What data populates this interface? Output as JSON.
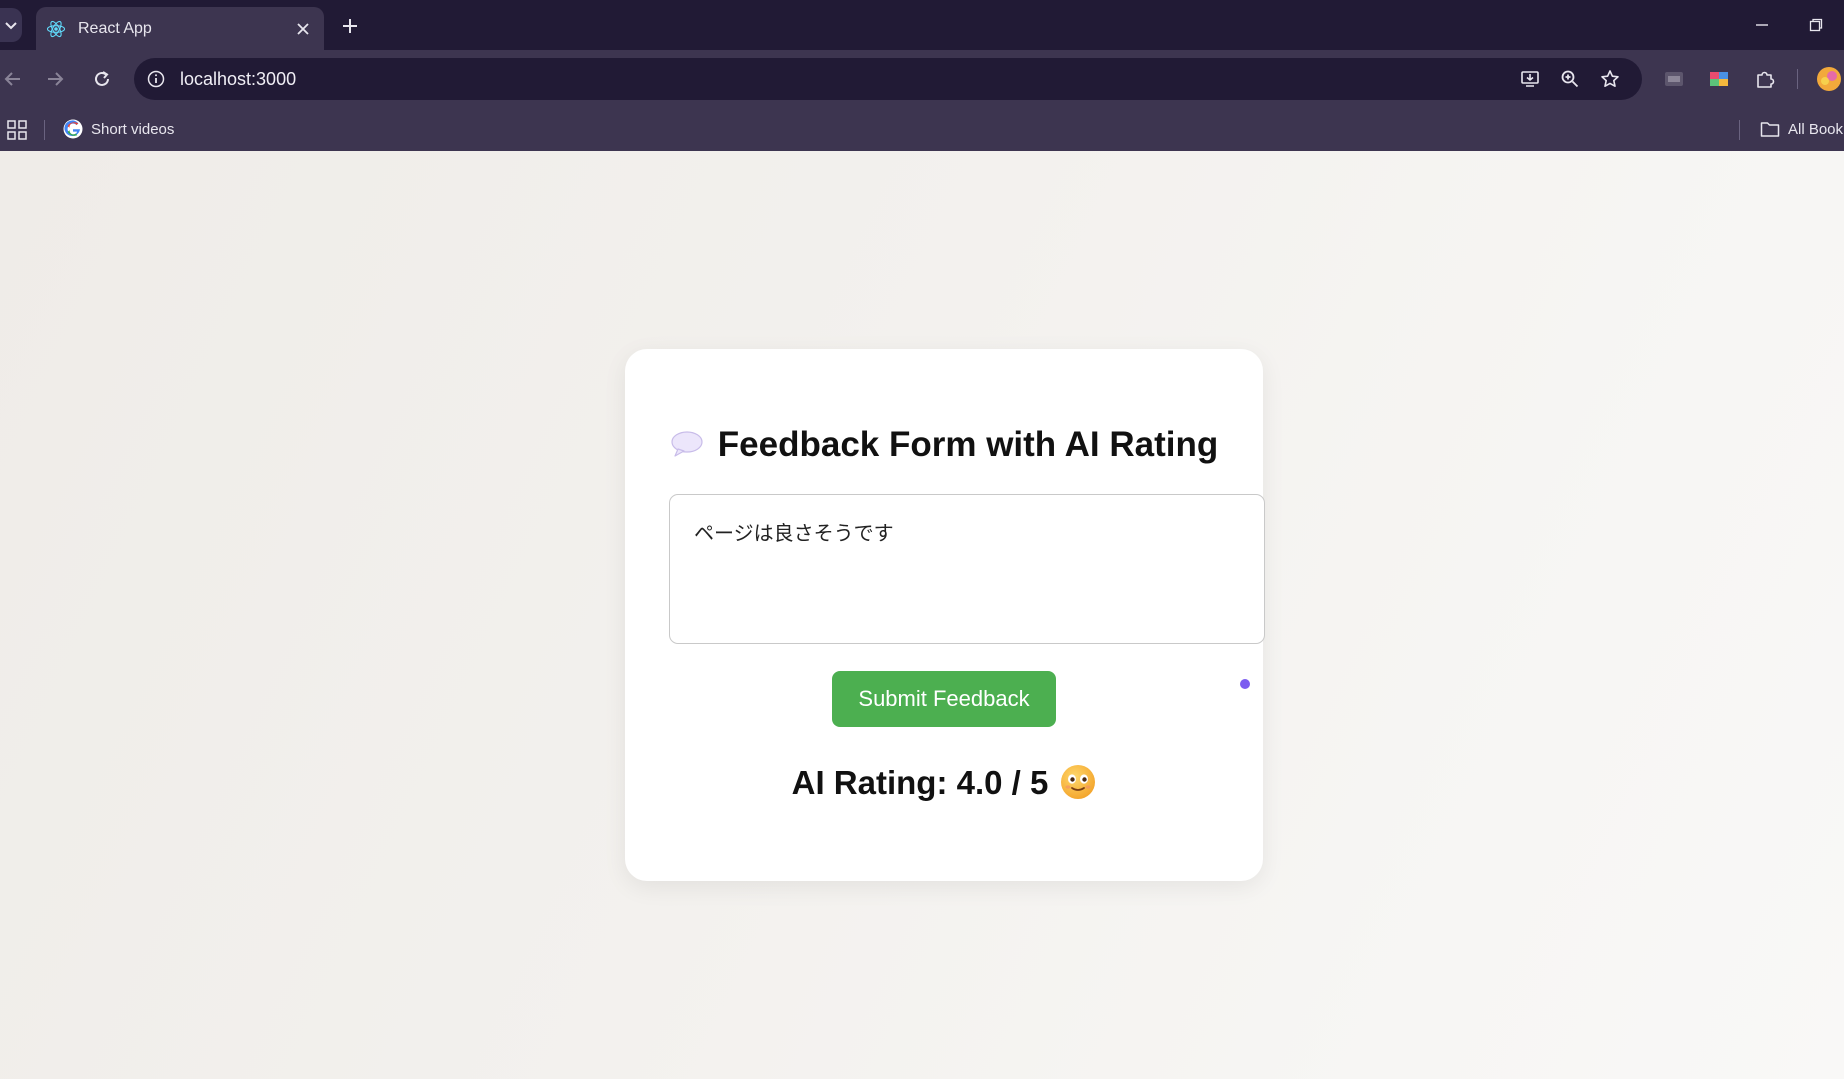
{
  "browser": {
    "tab_title": "React App",
    "url": "localhost:3000",
    "bookmarks": [
      {
        "label": "Short videos",
        "icon": "google-icon"
      }
    ],
    "all_bookmarks_label": "All Book"
  },
  "page": {
    "title": "Feedback Form with AI Rating",
    "title_icon": "speech-bubble-icon",
    "feedback_text": "ページは良さそうです",
    "submit_label": "Submit Feedback",
    "rating_text": "AI Rating: 4.0 / 5",
    "rating_icon": "smiley-face-icon"
  },
  "colors": {
    "submit_button": "#4caf50",
    "indicator_dot": "#7b5cf0",
    "chrome_dark": "#211a35",
    "chrome_mid": "#3d3550"
  }
}
